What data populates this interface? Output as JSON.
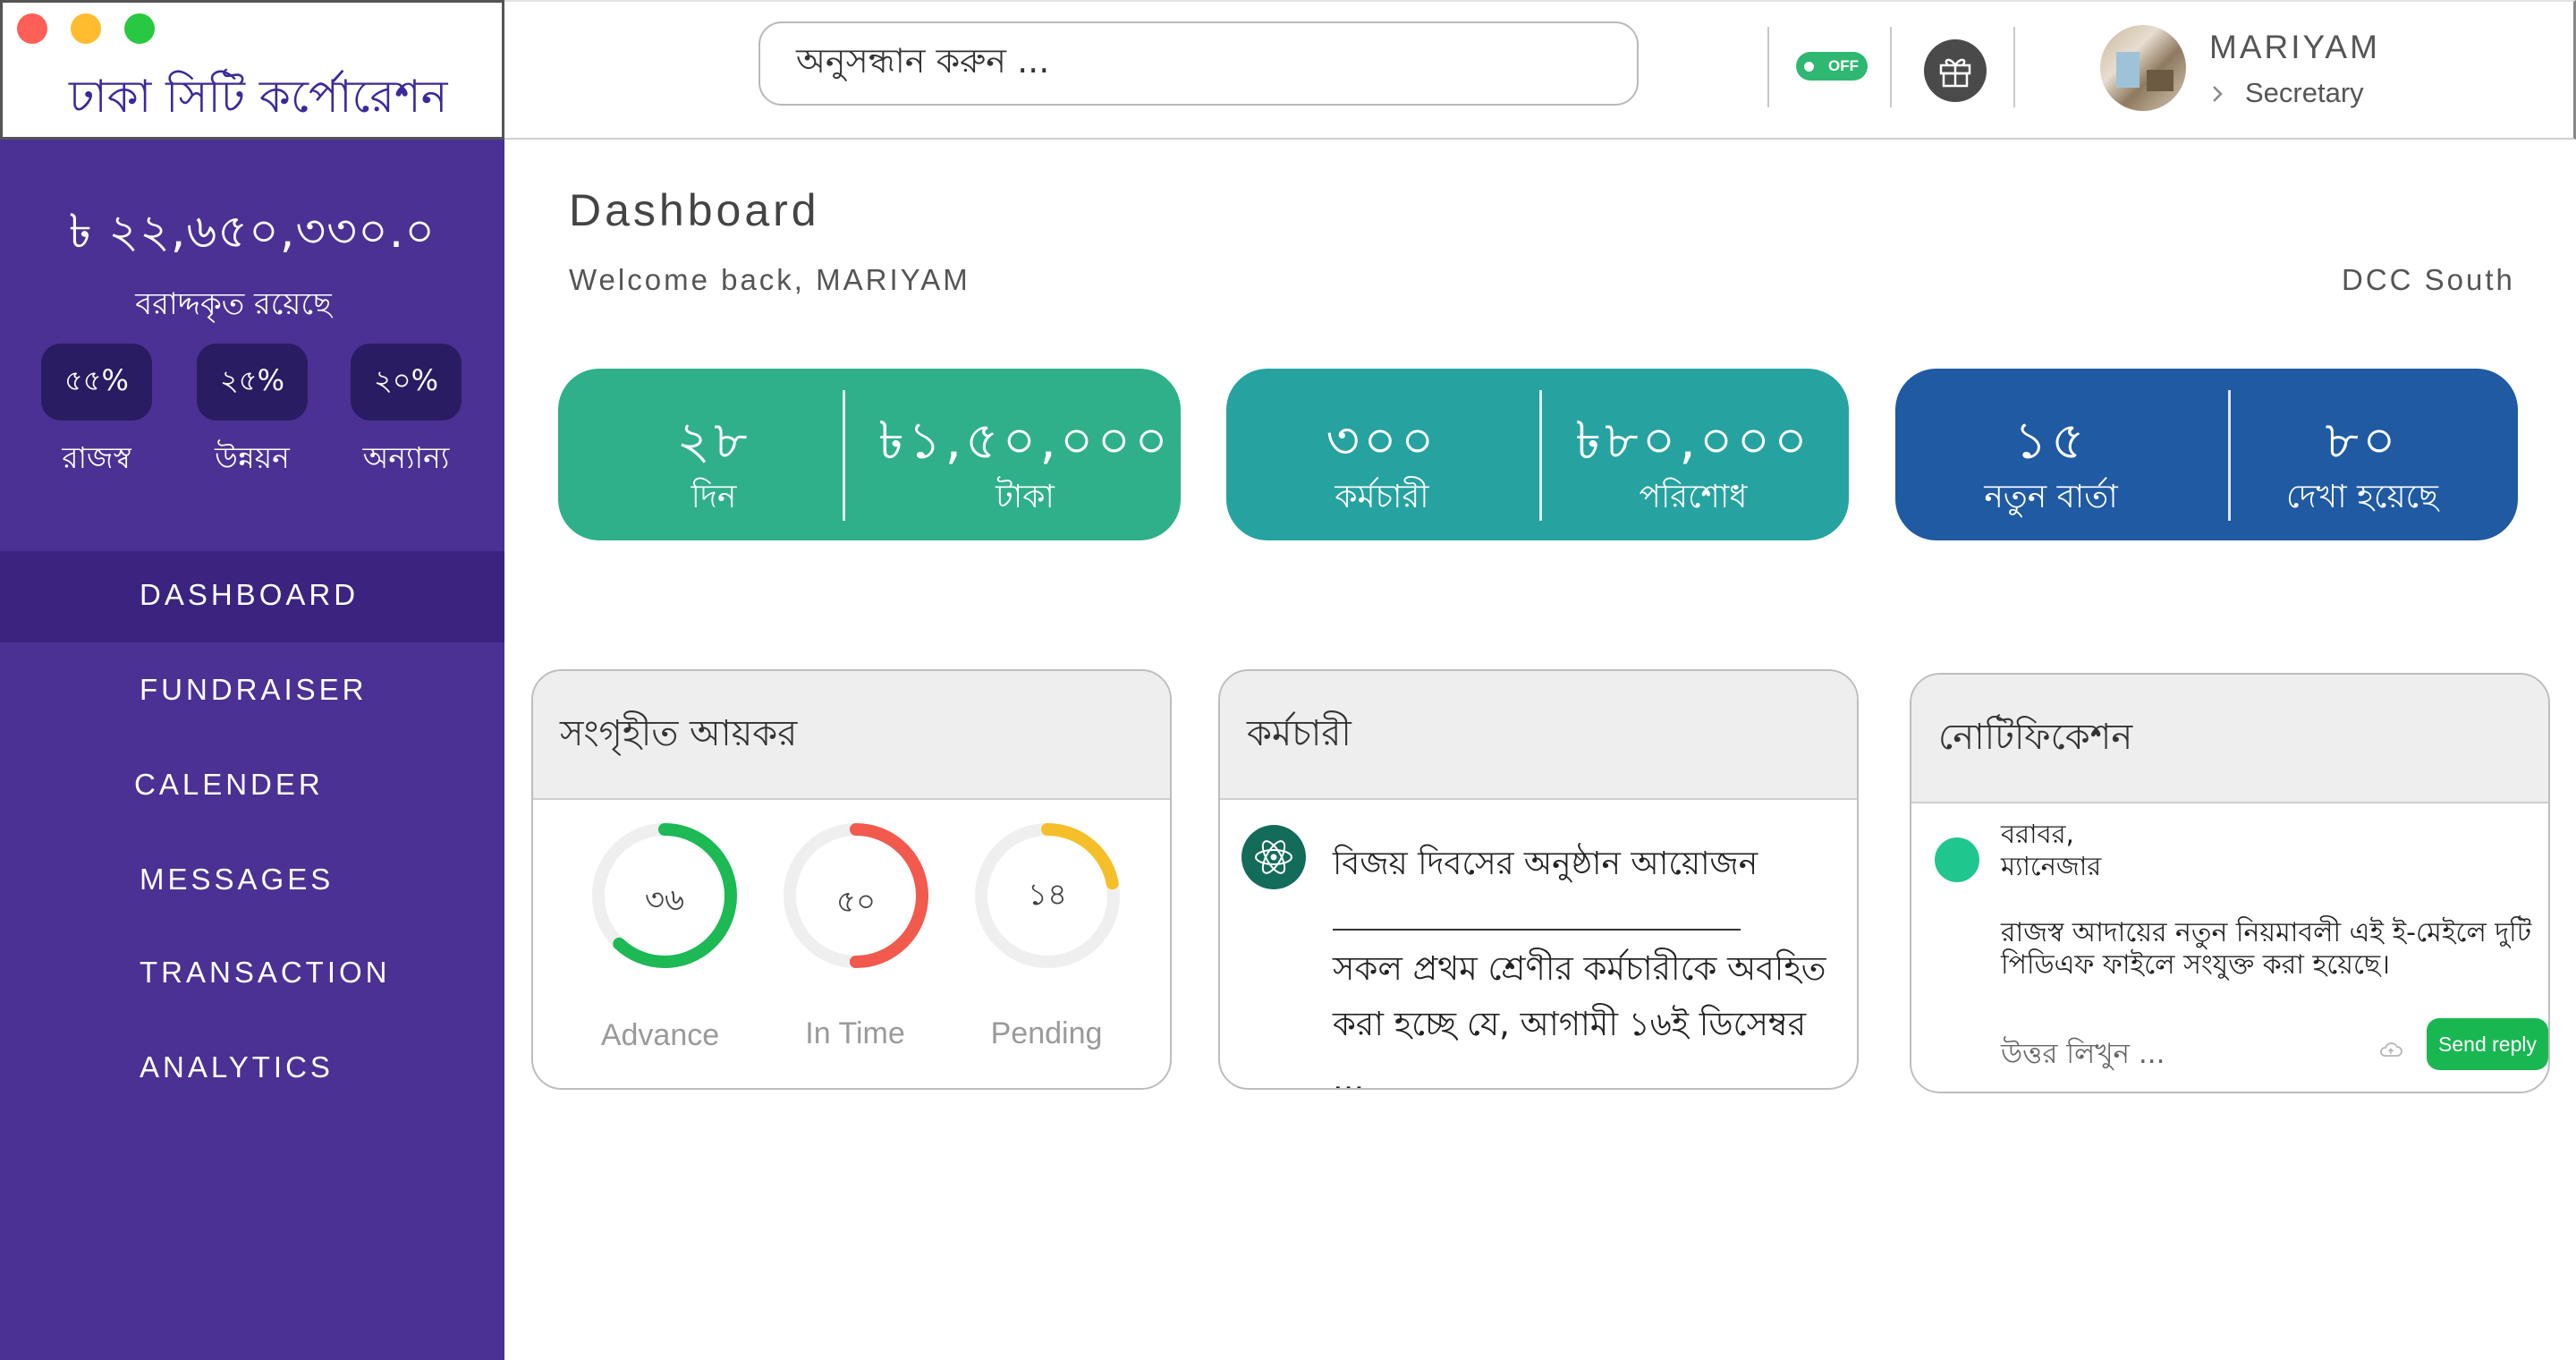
{
  "app": {
    "title": "ঢাকা সিটি কর্পোরেশন"
  },
  "header": {
    "search_placeholder": "অনুসন্ধান করুন ...",
    "toggle_label": "OFF",
    "user_name": "MARIYAM",
    "user_role": "Secretary"
  },
  "sidebar": {
    "balance": "৳ ২২,৬৫০,৩৩০.০",
    "balance_caption": "বরাদ্দকৃত রয়েছে",
    "allocations": [
      {
        "percent": "৫৫%",
        "label": "রাজস্ব"
      },
      {
        "percent": "২৫%",
        "label": "উন্নয়ন"
      },
      {
        "percent": "২০%",
        "label": "অন্যান্য"
      }
    ],
    "nav": [
      {
        "label": "DASHBOARD",
        "active": true
      },
      {
        "label": "FUNDRAISER",
        "active": false
      },
      {
        "label": "CALENDER",
        "active": false
      },
      {
        "label": "MESSAGES",
        "active": false
      },
      {
        "label": "TRANSACTION",
        "active": false
      },
      {
        "label": "ANALYTICS",
        "active": false
      }
    ]
  },
  "main": {
    "title": "Dashboard",
    "welcome": "Welcome back, MARIYAM",
    "region": "DCC South"
  },
  "stats": [
    {
      "color": "#2fb08a",
      "left": {
        "value": "২৮",
        "label": "দিন"
      },
      "right": {
        "value": "৳১,৫০,০০০",
        "label": "টাকা"
      }
    },
    {
      "color": "#26a3a0",
      "left": {
        "value": "৩০০",
        "label": "কর্মচারী"
      },
      "right": {
        "value": "৳৮০,০০০",
        "label": "পরিশোধ"
      }
    },
    {
      "color": "#1f5aa3",
      "left": {
        "value": "১৫",
        "label": "নতুন বার্তা"
      },
      "right": {
        "value": "৮০",
        "label": "দেখা হয়েছে"
      }
    }
  ],
  "tax_panel": {
    "title": "সংগৃহীত আয়কর",
    "gauges": [
      {
        "value": "৩৬",
        "label": "Advance",
        "fraction": 0.62,
        "color": "#1db954"
      },
      {
        "value": "৫০",
        "label": "In Time",
        "fraction": 0.5,
        "color": "#f25a4e"
      },
      {
        "value": "১৪",
        "label": "Pending",
        "fraction": 0.22,
        "color": "#f5bf2a"
      }
    ],
    "track_color": "#efefef"
  },
  "staff_panel": {
    "title": "কর্মচারী",
    "item_title": "বিজয় দিবসের অনুষ্ঠান আয়োজন",
    "body_line1": "সকল প্রথম শ্রেণীর কর্মচারীকে অবহিত",
    "body_line2": "করা হচ্ছে যে, আগামী ১৬ই ডিসেম্বর ..."
  },
  "notif_panel": {
    "title": "নোটিফিকেশন",
    "to_line1": "বরাবর,",
    "to_line2": "ম্যানেজার",
    "message_line1": "রাজস্ব আদায়ের নতুন নিয়মাবলী এই ই-মেইলে দুটি",
    "message_line2": "পিডিএফ ফাইলে সংযুক্ত করা হয়েছে।",
    "reply_placeholder": "উত্তর লিখুন ...",
    "send_label": "Send reply"
  }
}
